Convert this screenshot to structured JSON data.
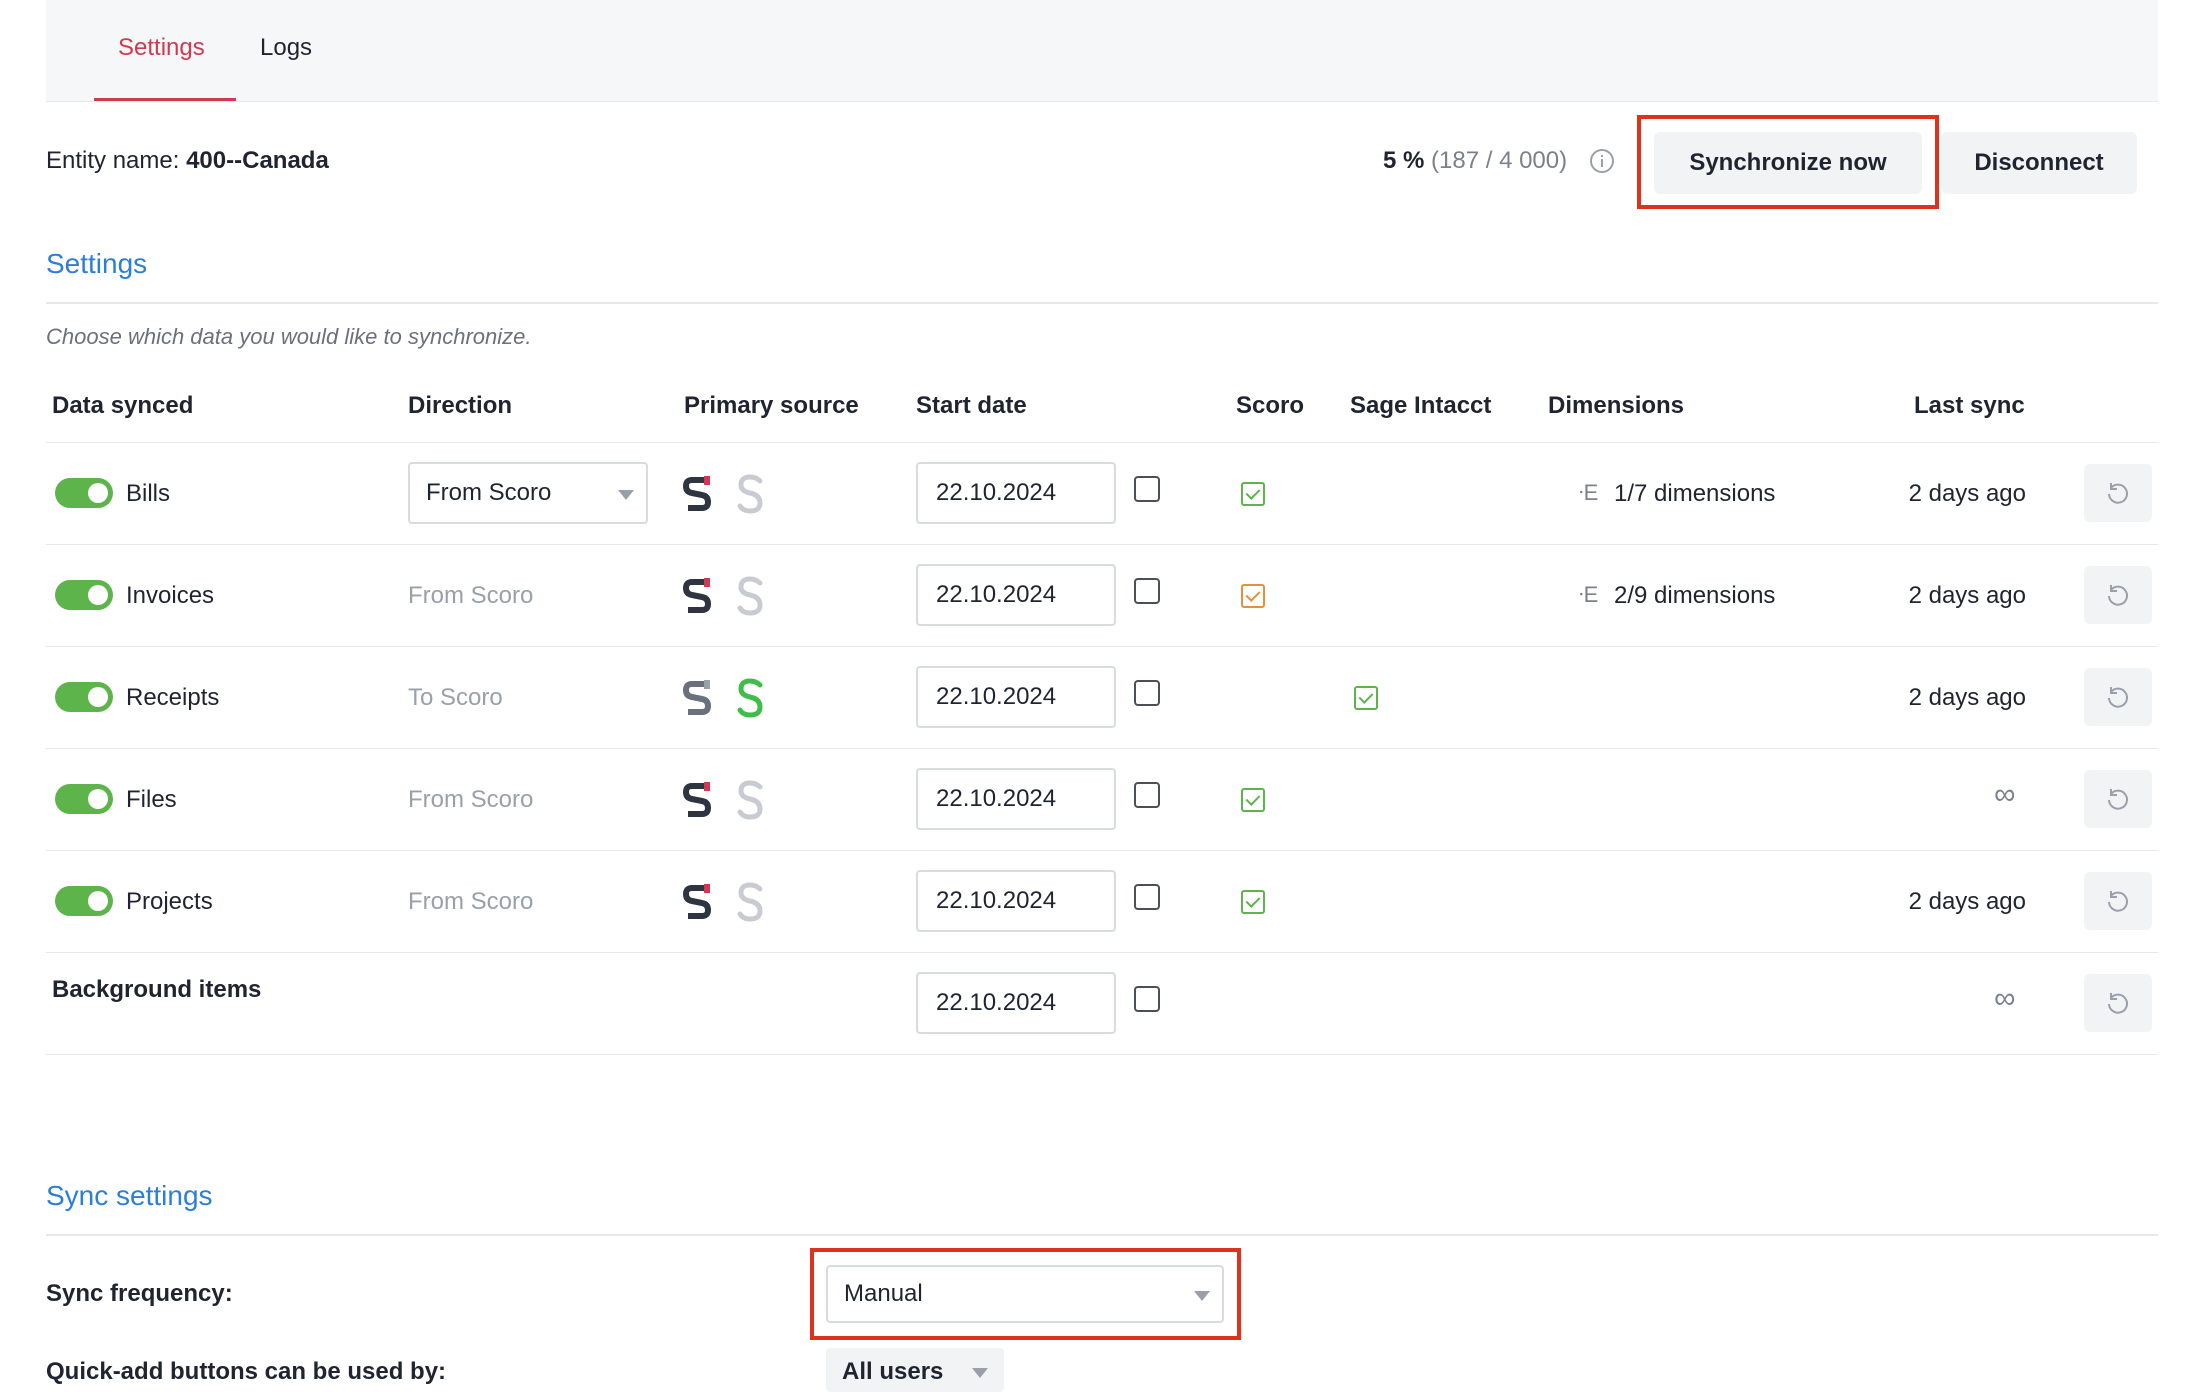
{
  "tabs": [
    {
      "label": "Settings",
      "active": true
    },
    {
      "label": "Logs",
      "active": false
    }
  ],
  "entity": {
    "label": "Entity name:",
    "value": "400--Canada"
  },
  "usage": {
    "percent": "5 %",
    "detail": "(187 / 4 000)"
  },
  "actions": {
    "sync_label": "Synchronize now",
    "disconnect_label": "Disconnect"
  },
  "settings": {
    "title": "Settings",
    "hint": "Choose which data you would like to synchronize.",
    "headers": {
      "data_synced": "Data synced",
      "direction": "Direction",
      "primary_source": "Primary source",
      "start_date": "Start date",
      "scoro": "Scoro",
      "sage": "Sage Intacct",
      "dimensions": "Dimensions",
      "last_sync": "Last sync"
    },
    "rows": [
      {
        "name": "Bills",
        "direction": "From Scoro",
        "start_date": "22.10.2024",
        "dimensions": "1/7 dimensions",
        "last_sync": "2 days ago"
      },
      {
        "name": "Invoices",
        "direction": "From Scoro",
        "start_date": "22.10.2024",
        "dimensions": "2/9 dimensions",
        "last_sync": "2 days ago"
      },
      {
        "name": "Receipts",
        "direction": "To Scoro",
        "start_date": "22.10.2024",
        "dimensions": "",
        "last_sync": "2 days ago"
      },
      {
        "name": "Files",
        "direction": "From Scoro",
        "start_date": "22.10.2024",
        "dimensions": "",
        "last_sync": "∞"
      },
      {
        "name": "Projects",
        "direction": "From Scoro",
        "start_date": "22.10.2024",
        "dimensions": "",
        "last_sync": "2 days ago"
      },
      {
        "name": "Background items",
        "direction": "",
        "start_date": "22.10.2024",
        "dimensions": "",
        "last_sync": "∞"
      }
    ]
  },
  "sync_settings": {
    "title": "Sync settings",
    "frequency_label": "Sync frequency:",
    "frequency_value": "Manual",
    "quick_add_label": "Quick-add buttons can be used by:",
    "quick_add_value": "All users"
  },
  "colors": {
    "accent": "#2c7fd4",
    "active_tab": "#d03a50",
    "toggle_on": "#5db44a",
    "highlight": "#e0301e",
    "warning": "#e3913a"
  }
}
